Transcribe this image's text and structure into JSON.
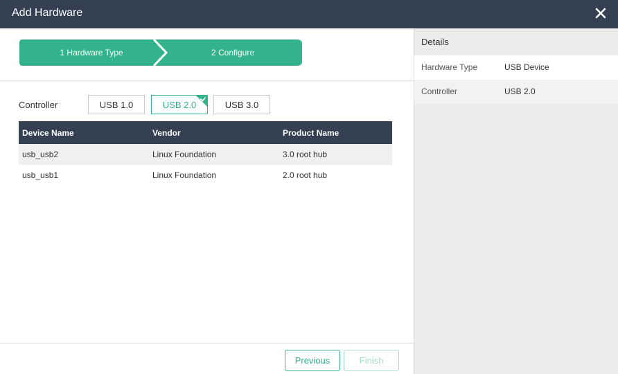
{
  "window": {
    "title": "Add Hardware"
  },
  "steps": [
    {
      "label": "1 Hardware Type"
    },
    {
      "label": "2 Configure"
    }
  ],
  "controller": {
    "label": "Controller",
    "options": [
      "USB 1.0",
      "USB 2.0",
      "USB 3.0"
    ],
    "selected": "USB 2.0"
  },
  "table": {
    "headers": [
      "Device Name",
      "Vendor",
      "Product Name"
    ],
    "rows": [
      [
        "usb_usb2",
        "Linux Foundation",
        "3.0 root hub"
      ],
      [
        "usb_usb1",
        "Linux Foundation",
        "2.0 root hub"
      ]
    ]
  },
  "footer": {
    "previous_label": "Previous",
    "finish_label": "Finish"
  },
  "details": {
    "title": "Details",
    "items": [
      {
        "key": "Hardware Type",
        "value": "USB Device"
      },
      {
        "key": "Controller",
        "value": "USB 2.0"
      }
    ]
  },
  "colors": {
    "accent": "#33b38c",
    "header": "#343f52"
  },
  "icons": {
    "close": "close-icon",
    "check": "check-icon"
  }
}
